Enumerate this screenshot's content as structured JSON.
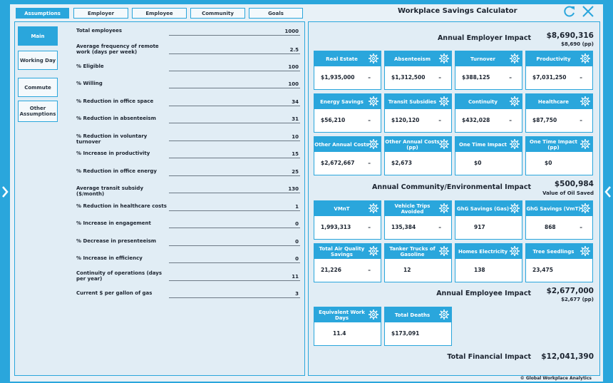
{
  "app": {
    "title": "Workplace Savings Calculator",
    "copyright": "© Global Workplace Analytics"
  },
  "tabs": [
    {
      "label": "Assumptions",
      "active": true
    },
    {
      "label": "Employer",
      "active": false
    },
    {
      "label": "Employee",
      "active": false
    },
    {
      "label": "Community",
      "active": false
    },
    {
      "label": "Goals",
      "active": false
    }
  ],
  "subnav": [
    {
      "label": "Main",
      "active": true
    },
    {
      "label": "Working Day",
      "active": false
    },
    {
      "label": "Commute",
      "active": false
    },
    {
      "label": "Other Assumptions",
      "active": false
    }
  ],
  "fields": [
    {
      "label": "Total employees",
      "value": "1000"
    },
    {
      "label": "Average frequency of remote work (days per week)",
      "value": "2.5"
    },
    {
      "label": "% Eligible",
      "value": "100"
    },
    {
      "label": "% Willing",
      "value": "100"
    },
    {
      "label": "% Reduction in office space",
      "value": "34"
    },
    {
      "label": "% Reduction in absenteeism",
      "value": "31"
    },
    {
      "label": "% Reduction in voluntary turnover",
      "value": "10"
    },
    {
      "label": "% Increase in productivity",
      "value": "15"
    },
    {
      "label": "% Reduction in office energy",
      "value": "25"
    },
    {
      "label": "Average transit subsidy ($/month)",
      "value": "130"
    },
    {
      "label": "% Reduction in healthcare costs",
      "value": "1"
    },
    {
      "label": "% Increase in engagement",
      "value": "0"
    },
    {
      "label": "% Decrease in presenteeism",
      "value": "0"
    },
    {
      "label": "% Increase in efficiency",
      "value": "0"
    },
    {
      "label": "Continuity of operations (days per year)",
      "value": "11"
    },
    {
      "label": "Current $ per gallon of gas",
      "value": "3"
    }
  ],
  "employer": {
    "title": "Annual Employer Impact",
    "value": "$8,690,316",
    "sub": "$8,690 (pp)",
    "cards": [
      {
        "name": "Real Estate",
        "value": "$1,935,000",
        "dash": "–"
      },
      {
        "name": "Absenteeism",
        "value": "$1,312,500",
        "dash": "–"
      },
      {
        "name": "Turnover",
        "value": "$388,125",
        "dash": "–"
      },
      {
        "name": "Productivity",
        "value": "$7,031,250",
        "dash": "–"
      },
      {
        "name": "Energy Savings",
        "value": "$56,210",
        "dash": "–"
      },
      {
        "name": "Transit Subsidies",
        "value": "$120,120",
        "dash": "–"
      },
      {
        "name": "Continuity",
        "value": "$432,028",
        "dash": "–"
      },
      {
        "name": "Healthcare",
        "value": "$87,750",
        "dash": "–"
      },
      {
        "name": "Other Annual Costs",
        "value": "$2,672,667",
        "dash": "–"
      },
      {
        "name": "Other Annual Costs (pp)",
        "value": "$2,673",
        "dash": ""
      },
      {
        "name": "One Time Impact",
        "value": "$0",
        "dash": ""
      },
      {
        "name": "One Time Impact (pp)",
        "value": "$0",
        "dash": ""
      }
    ]
  },
  "community": {
    "title": "Annual Community/Environmental Impact",
    "value": "$500,984",
    "sub": "Value of Oil Saved",
    "cards": [
      {
        "name": "VMnT",
        "value": "1,993,313",
        "dash": "–"
      },
      {
        "name": "Vehicle Trips Avoided",
        "value": "135,384",
        "dash": "–"
      },
      {
        "name": "GhG Savings (Gas)",
        "value": "917",
        "dash": ""
      },
      {
        "name": "GhG Savings (VmT)",
        "value": "868",
        "dash": "–"
      },
      {
        "name": "Total Air Quality Savings",
        "value": "21,226",
        "dash": "–"
      },
      {
        "name": "Tanker Trucks of Gasoline",
        "value": "12",
        "dash": ""
      },
      {
        "name": "Homes Electricity",
        "value": "138",
        "dash": ""
      },
      {
        "name": "Tree Seedlings",
        "value": "23,475",
        "dash": ""
      }
    ]
  },
  "employee": {
    "title": "Annual Employee Impact",
    "value": "$2,677,000",
    "sub": "$2,677 (pp)",
    "cards": [
      {
        "name": "Equivalent Work Days",
        "value": "11.4",
        "dash": ""
      },
      {
        "name": "Total Deaths",
        "value": "$173,091",
        "dash": ""
      }
    ]
  },
  "total": {
    "title": "Total Financial Impact",
    "value": "$12,041,390"
  },
  "colors": {
    "accent": "#2aa6dc",
    "panel": "#e1edf5",
    "card": "#ffffff",
    "text": "#1c2430"
  },
  "icons": [
    "refresh-icon",
    "close-icon",
    "gear-icon",
    "chevron-left-icon",
    "chevron-right-icon"
  ]
}
